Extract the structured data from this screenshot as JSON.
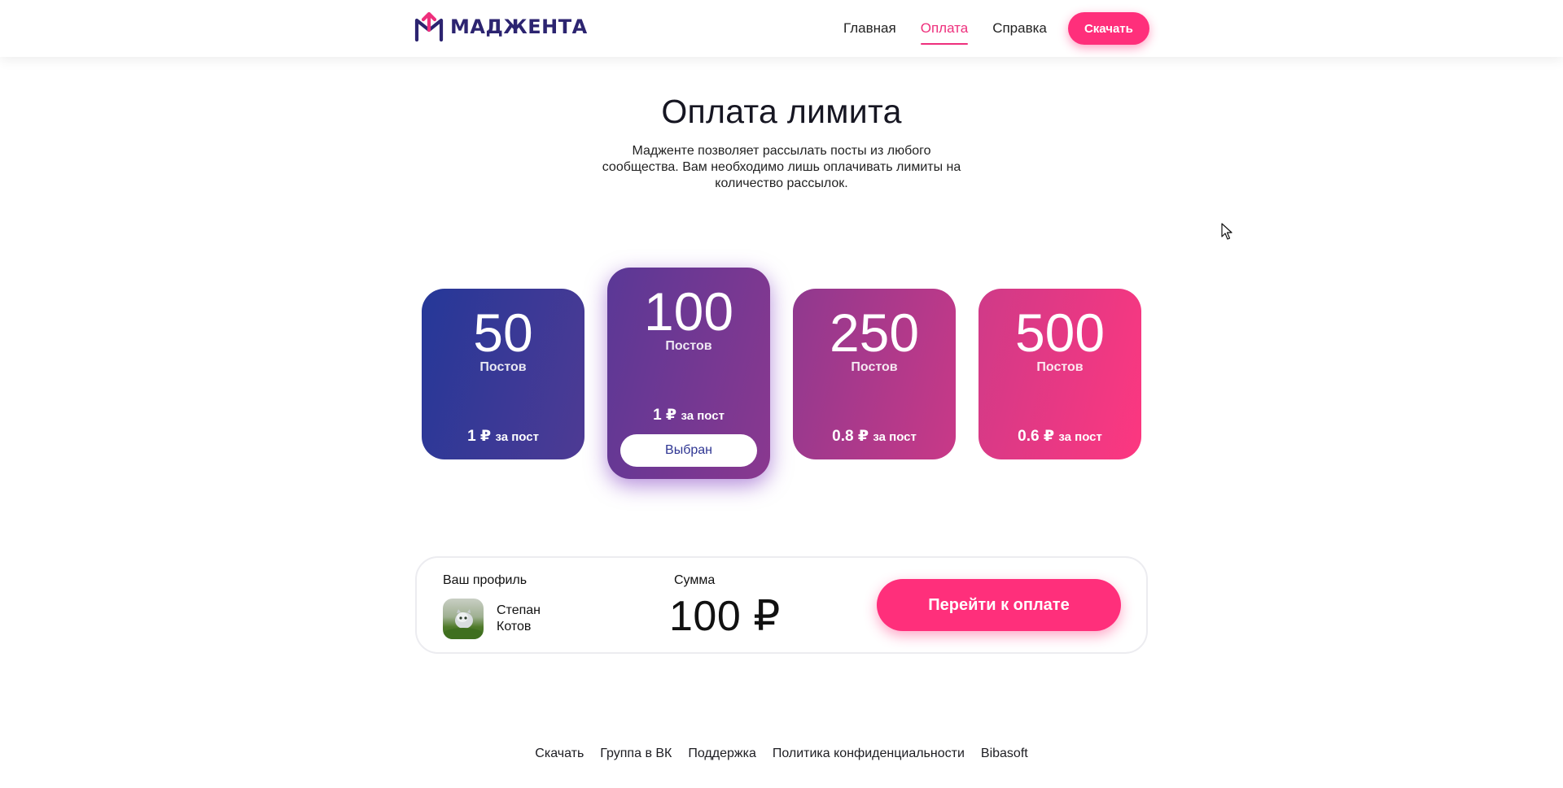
{
  "header": {
    "logo_text": "МАДЖЕНТА",
    "nav": [
      {
        "label": "Главная",
        "active": false
      },
      {
        "label": "Оплата",
        "active": true
      },
      {
        "label": "Справка",
        "active": false
      }
    ],
    "download_label": "Скачать"
  },
  "hero": {
    "title": "Оплата лимита",
    "description": "Мадженте позволяет рассылать посты из любого сообщества. Вам необходимо лишь оплачивать лимиты на количество рассылок."
  },
  "plans": [
    {
      "count": "50",
      "unit": "Постов",
      "price": "1 ₽",
      "per": "за пост",
      "selected": false
    },
    {
      "count": "100",
      "unit": "Постов",
      "price": "1 ₽",
      "per": "за пост",
      "selected": true,
      "selected_label": "Выбран"
    },
    {
      "count": "250",
      "unit": "Постов",
      "price": "0.8 ₽",
      "per": "за пост",
      "selected": false
    },
    {
      "count": "500",
      "unit": "Постов",
      "price": "0.6 ₽",
      "per": "за пост",
      "selected": false
    }
  ],
  "payment": {
    "profile_label": "Ваш профиль",
    "profile_name": "Степан Котов",
    "sum_label": "Сумма",
    "sum_value": "100 ₽",
    "pay_button": "Перейти к оплате"
  },
  "footer": {
    "links": [
      "Скачать",
      "Группа в ВК",
      "Поддержка",
      "Политика конфиденциальности",
      "Bibasoft"
    ]
  },
  "colors": {
    "accent": "#ff2f7b",
    "brand_dark": "#2c2470",
    "card_50": "#253898",
    "card_100": "#7a388f",
    "card_250": "#b0398b",
    "card_500": "#fd3780"
  },
  "icons": {
    "logo": "magenta-logo-icon",
    "cursor": "mouse-pointer-icon"
  }
}
